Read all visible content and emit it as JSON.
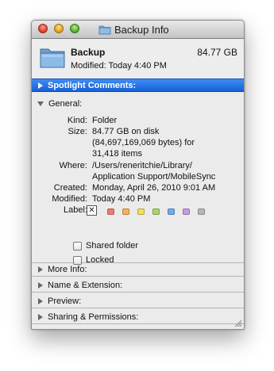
{
  "window": {
    "title": "Backup Info"
  },
  "header": {
    "name": "Backup",
    "size": "84.77 GB",
    "modified": "Modified: Today 4:40 PM"
  },
  "sections": {
    "spotlight": "Spotlight Comments:",
    "general": "General:",
    "more_info": "More Info:",
    "name_ext": "Name & Extension:",
    "preview": "Preview:",
    "sharing": "Sharing & Permissions:"
  },
  "general": {
    "kind_key": "Kind:",
    "kind": "Folder",
    "size_key": "Size:",
    "size_1": "84.77 GB on disk",
    "size_2": "(84,697,169,069 bytes) for",
    "size_3": "31,418 items",
    "where_key": "Where:",
    "where_1": "/Users/reneritchie/Library/",
    "where_2": "Application Support/MobileSync",
    "created_key": "Created:",
    "created": "Monday, April 26, 2010 9:01 AM",
    "modified_key": "Modified:",
    "modified": "Today 4:40 PM",
    "label_key": "Label:",
    "label_none": "✕",
    "label_colors": [
      "#f07c6e",
      "#f4b15a",
      "#f2df5a",
      "#a8d56a",
      "#6eaaf0",
      "#c79ae2",
      "#b7b7b7"
    ],
    "shared_folder": "Shared folder",
    "locked": "Locked"
  }
}
